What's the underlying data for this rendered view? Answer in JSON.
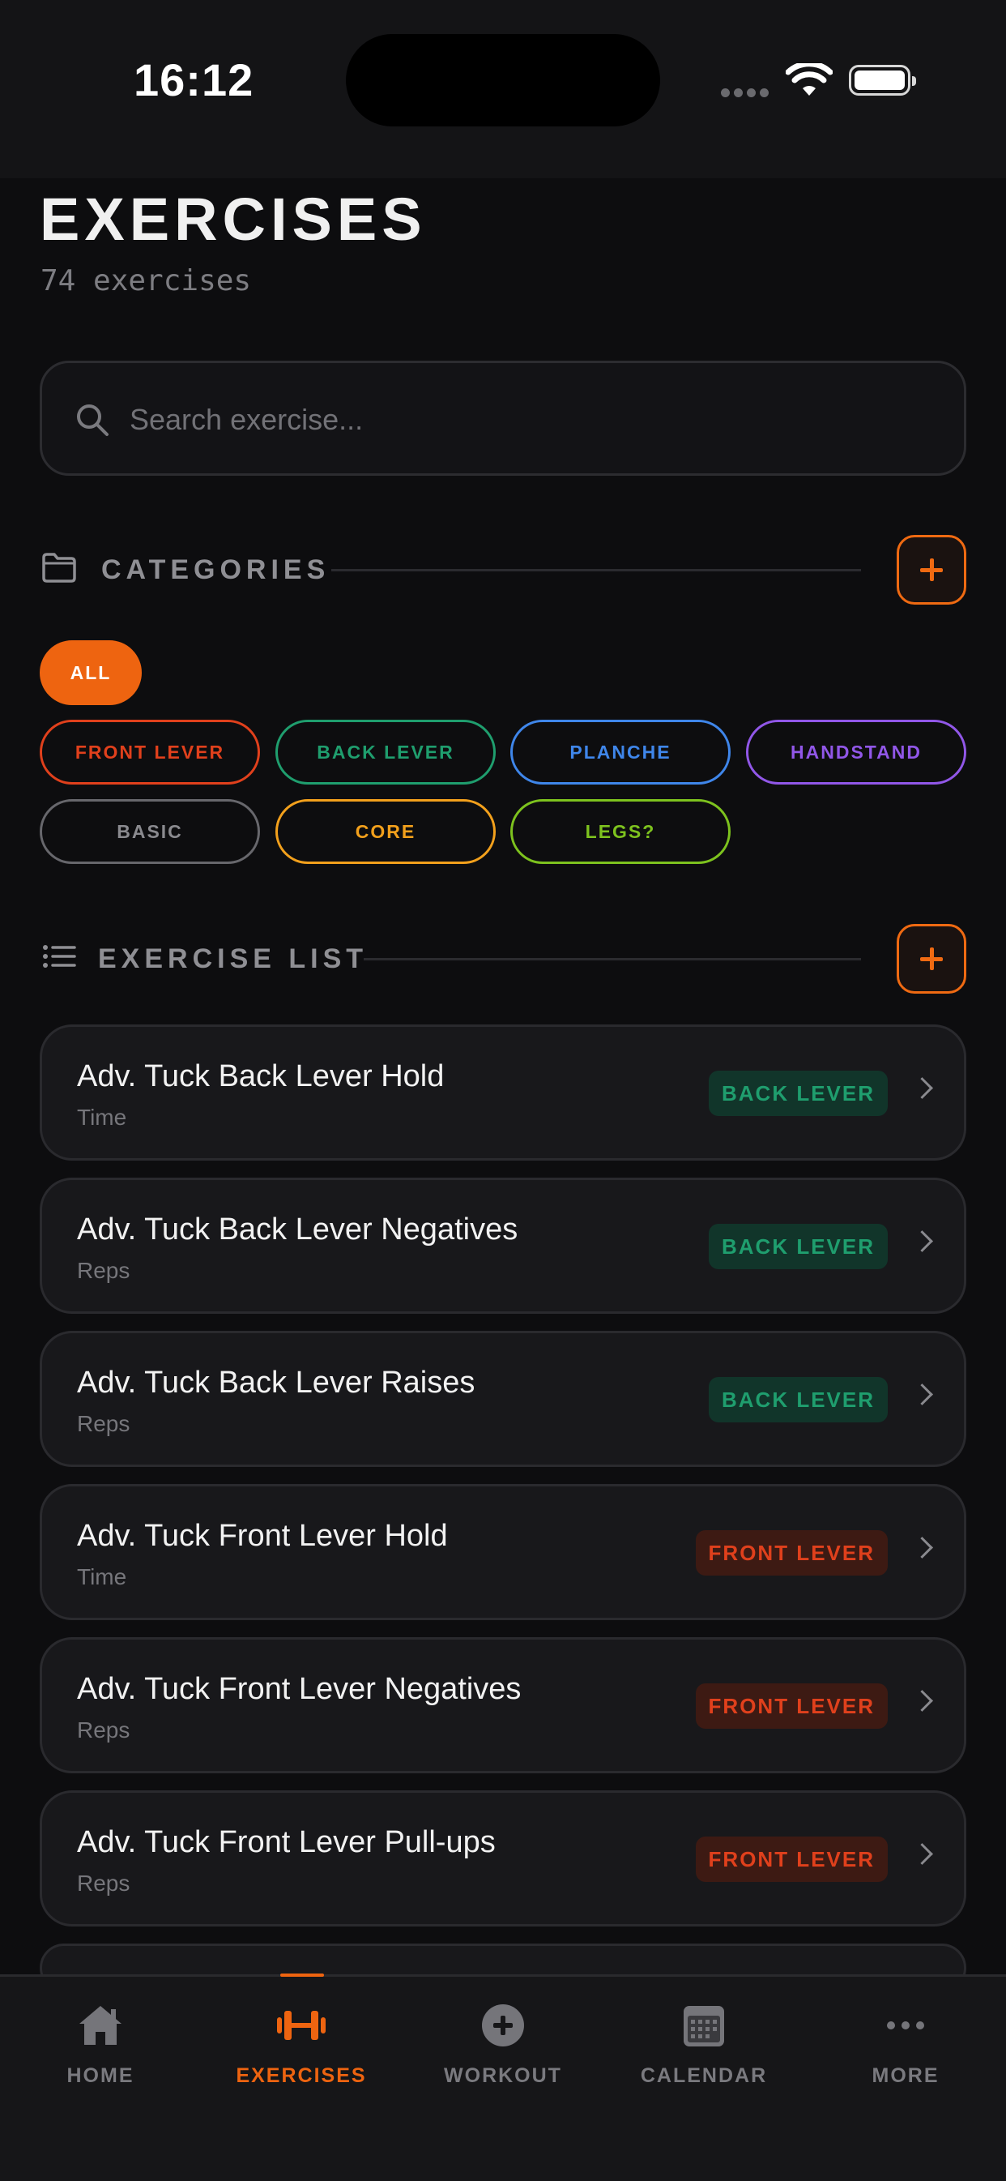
{
  "status": {
    "time": "16:12"
  },
  "header": {
    "title": "EXERCISES",
    "subtitle": "74 exercises"
  },
  "search": {
    "placeholder": "Search exercise..."
  },
  "categories": {
    "label": "CATEGORIES",
    "all_label": "ALL",
    "chips": [
      {
        "label": "FRONT LEVER",
        "color": "#e0401c"
      },
      {
        "label": "BACK LEVER",
        "color": "#1f9e6e"
      },
      {
        "label": "PLANCHE",
        "color": "#3f86ea"
      },
      {
        "label": "HANDSTAND",
        "color": "#9157e8"
      },
      {
        "label": "BASIC",
        "color": "#7b7b80"
      },
      {
        "label": "CORE",
        "color": "#f2a01c"
      },
      {
        "label": "LEGS?",
        "color": "#7dc21e"
      }
    ]
  },
  "exercise_list": {
    "label": "EXERCISE LIST",
    "items": [
      {
        "name": "Adv. Tuck Back Lever Hold",
        "type": "Time",
        "tag": "BACK LEVER"
      },
      {
        "name": "Adv. Tuck Back Lever Negatives",
        "type": "Reps",
        "tag": "BACK LEVER"
      },
      {
        "name": "Adv. Tuck Back Lever Raises",
        "type": "Reps",
        "tag": "BACK LEVER"
      },
      {
        "name": "Adv. Tuck Front Lever Hold",
        "type": "Time",
        "tag": "FRONT LEVER"
      },
      {
        "name": "Adv. Tuck Front Lever Negatives",
        "type": "Reps",
        "tag": "FRONT LEVER"
      },
      {
        "name": "Adv. Tuck Front Lever Pull-ups",
        "type": "Reps",
        "tag": "FRONT LEVER"
      }
    ]
  },
  "tabs": [
    {
      "label": "HOME",
      "icon": "home-icon"
    },
    {
      "label": "EXERCISES",
      "icon": "dumbbell-icon",
      "active": true
    },
    {
      "label": "WORKOUT",
      "icon": "plus-circle-icon"
    },
    {
      "label": "CALENDAR",
      "icon": "calendar-icon"
    },
    {
      "label": "MORE",
      "icon": "more-icon"
    }
  ],
  "colors": {
    "accent": "#ee6410",
    "background": "#0d0d0f",
    "card": "#18181b"
  }
}
